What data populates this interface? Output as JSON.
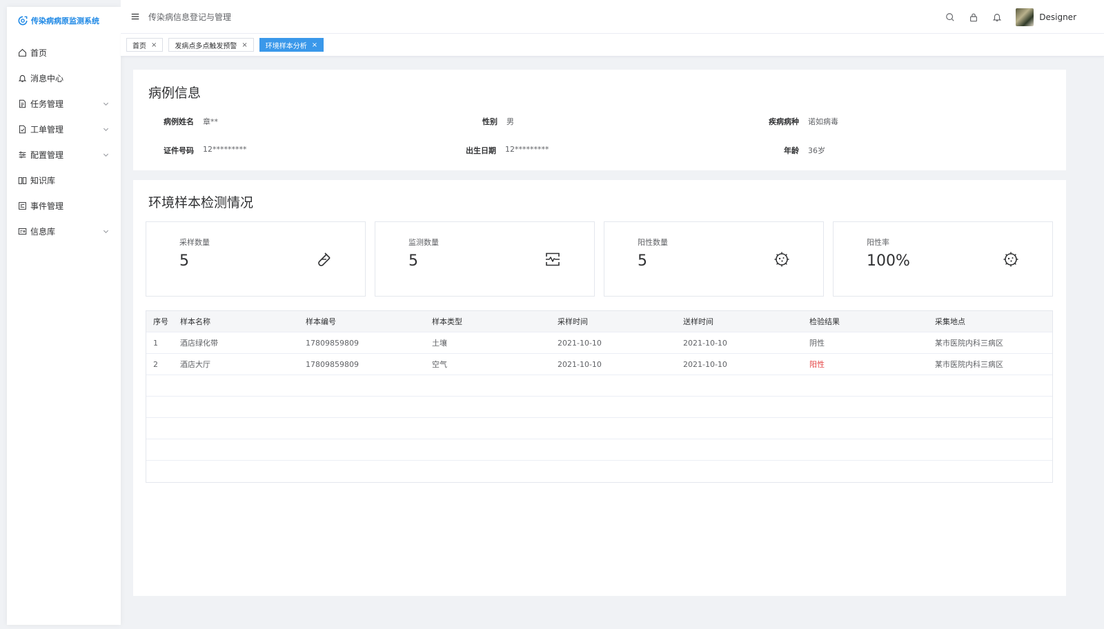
{
  "app": {
    "name": "传染病病原监测系统",
    "brand_color": "#1e88e5"
  },
  "sidebar": {
    "items": [
      {
        "label": "首页",
        "icon": "home-icon",
        "expandable": false
      },
      {
        "label": "消息中心",
        "icon": "bell-icon",
        "expandable": false
      },
      {
        "label": "任务管理",
        "icon": "document-icon",
        "expandable": true
      },
      {
        "label": "工单管理",
        "icon": "document-edit-icon",
        "expandable": true
      },
      {
        "label": "配置管理",
        "icon": "sliders-icon",
        "expandable": true
      },
      {
        "label": "知识库",
        "icon": "book-icon",
        "expandable": false
      },
      {
        "label": "事件管理",
        "icon": "event-icon",
        "expandable": false
      },
      {
        "label": "信息库",
        "icon": "card-icon",
        "expandable": true
      }
    ]
  },
  "header": {
    "title": "传染病信息登记与管理",
    "username": "Designer"
  },
  "tabs": [
    {
      "label": "首页",
      "active": false
    },
    {
      "label": "发病点多点触发预警",
      "active": false
    },
    {
      "label": "环境样本分析",
      "active": true
    }
  ],
  "case_info": {
    "title": "病例信息",
    "fields": [
      {
        "label": "病例姓名",
        "value": "章**"
      },
      {
        "label": "性别",
        "value": "男"
      },
      {
        "label": "疾病病种",
        "value": "诺如病毒"
      },
      {
        "label": "证件号码",
        "value": "12*********"
      },
      {
        "label": "出生日期",
        "value": "12*********"
      },
      {
        "label": "年龄",
        "value": "36岁"
      }
    ]
  },
  "env_samples": {
    "title": "环境样本检测情况",
    "stats": [
      {
        "label": "采样数量",
        "value": "5",
        "icon": "test-tube-icon"
      },
      {
        "label": "监测数量",
        "value": "5",
        "icon": "monitor-icon"
      },
      {
        "label": "阳性数量",
        "value": "5",
        "icon": "virus-icon"
      },
      {
        "label": "阳性率",
        "value": "100%",
        "icon": "virus-icon"
      }
    ],
    "table": {
      "columns": [
        "序号",
        "样本名称",
        "样本编号",
        "样本类型",
        "采样时间",
        "送样时间",
        "检验结果",
        "采集地点"
      ],
      "rows": [
        [
          "1",
          "酒店绿化带",
          "17809859809",
          "土壤",
          "2021-10-10",
          "2021-10-10",
          "阴性",
          "某市医院内科三病区"
        ],
        [
          "2",
          "酒店大厅",
          "17809859809",
          "空气",
          "2021-10-10",
          "2021-10-10",
          "阳性",
          "某市医院内科三病区"
        ]
      ],
      "positive_color": "#e54545"
    }
  }
}
